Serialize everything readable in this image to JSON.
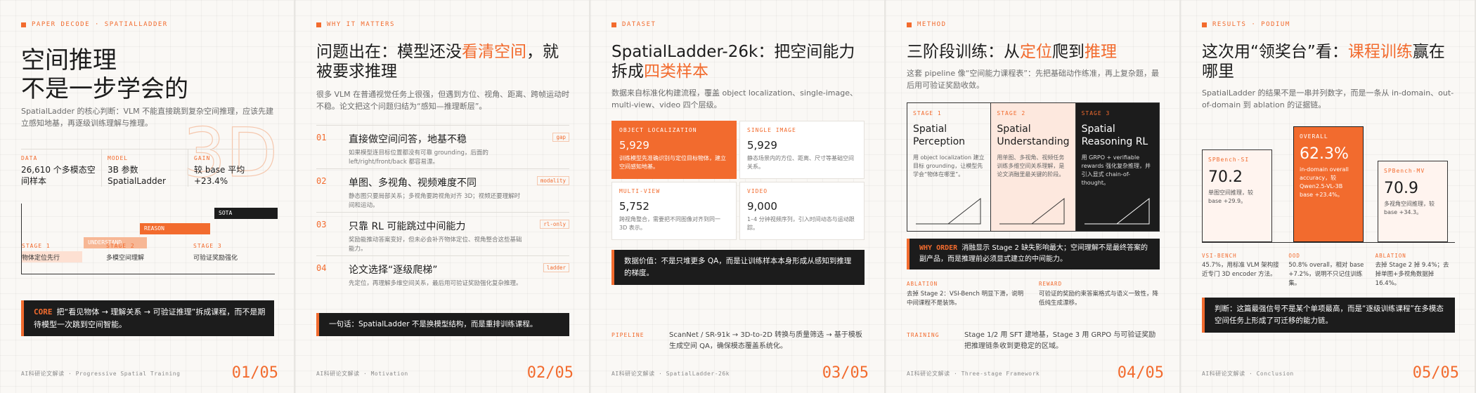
{
  "slides": [
    {
      "kicker": "PAPER DECODE · SPATIALLADDER",
      "title_line1": "空间推理",
      "title_line2": "不是一步学会的",
      "lead": "SpatialLadder 的核心判断：VLM 不能直接跳到复杂空间推理，应该先建立感知地基，再逐级训练理解与推理。",
      "big_text": "3D",
      "stats": [
        {
          "label": "DATA",
          "value": "26,610 个多模态空间样本"
        },
        {
          "label": "MODEL",
          "value": "3B 参数 SpatialLadder"
        },
        {
          "label": "GAIN",
          "value": "较 base 平均 +23.4%"
        }
      ],
      "ladder": {
        "sota": "SOTA",
        "reason": "REASON",
        "understand": "UNDERSTAND",
        "stage1_label": "STAGE 1",
        "stage1_desc": "物体定位先行",
        "stage2_label": "STAGE 2",
        "stage2_desc": "多模空间理解",
        "stage3_label": "STAGE 3",
        "stage3_desc": "可验证奖励强化"
      },
      "core_tag": "CORE",
      "core_text": "把“看见物体 → 理解关系 → 可验证推理”拆成课程，而不是期待模型一次跳到空间智能。",
      "footer_left": "AI科研论文解读 · Progressive Spatial Training",
      "page": "01/05"
    },
    {
      "kicker": "WHY IT MATTERS",
      "title_a": "问题出在：模型还没",
      "title_hl": "看清空间",
      "title_b": "，就被要求推理",
      "lead": "很多 VLM 在普通视觉任务上很强，但遇到方位、视角、距离、跨帧运动时不稳。论文把这个问题归结为“感知—推理断层”。",
      "problems": [
        {
          "num": "01",
          "title": "直接做空间问答，地基不稳",
          "desc": "如果模型连目标位置都没有可靠 grounding，后面的 left/right/front/back 都容易漂。",
          "chip": "gap"
        },
        {
          "num": "02",
          "title": "单图、多视角、视频难度不同",
          "desc": "静态图只要局部关系；多视角要跨视角对齐 3D；视频还要理解时间和运动。",
          "chip": "modality"
        },
        {
          "num": "03",
          "title": "只靠 RL 可能跳过中间能力",
          "desc": "奖励能推动答案变好，但未必会补齐物体定位、视角整合这些基础能力。",
          "chip": "rl-only"
        },
        {
          "num": "04",
          "title": "论文选择“逐级爬梯”",
          "desc": "先定位，再理解多维空间关系，最后用可验证奖励强化复杂推理。",
          "chip": "ladder"
        }
      ],
      "summary": "一句话：SpatialLadder 不是换模型结构，而是重排训练课程。",
      "footer_left": "AI科研论文解读 · Motivation",
      "page": "02/05"
    },
    {
      "kicker": "DATASET",
      "title_a": "SpatialLadder-26k：把空间能力拆成",
      "title_hl": "四类样本",
      "lead": "数据来自标准化构建流程，覆盖 object localization、single-image、multi-view、video 四个层级。",
      "cards": [
        {
          "label": "OBJECT LOCALIZATION",
          "value": "5,929",
          "desc": "训练模型先准确识别与定位目标物体，建立空间感知地基。"
        },
        {
          "label": "SINGLE IMAGE",
          "value": "5,929",
          "desc": "静态场景内的方位、距离、尺寸等基础空间关系。"
        },
        {
          "label": "MULTI-VIEW",
          "value": "5,752",
          "desc": "跨视角整合，需要把不同图像对齐到同一 3D 表示。"
        },
        {
          "label": "VIDEO",
          "value": "9,000",
          "desc": "1–4 分钟视频序列，引入时间动态与运动跟踪。"
        }
      ],
      "value_note": "数据价值：不是只堆更多 QA，而是让训练样本本身形成从感知到推理的梯度。",
      "pipeline_label": "PIPELINE",
      "pipeline_text": "ScanNet / SR-91k → 3D-to-2D 转换与质量筛选 → 基于模板生成空间 QA，确保模态覆盖系统化。",
      "footer_left": "AI科研论文解读 · SpatialLadder-26k",
      "page": "03/05"
    },
    {
      "kicker": "METHOD",
      "title_a": "三阶段训练：从",
      "title_hl1": "定位",
      "title_b": "爬到",
      "title_hl2": "推理",
      "lead": "这套 pipeline 像“空间能力课程表”：先把基础动作练准，再上复杂题，最后用可验证奖励收敛。",
      "stages": [
        {
          "label": "STAGE 1",
          "name": "Spatial Perception",
          "desc": "用 object localization 建立目标 grounding，让模型先学会“物体在哪里”。"
        },
        {
          "label": "STAGE 2",
          "name": "Spatial Understanding",
          "desc": "用单图、多视角、视频任务训练多维空间关系理解，是论文消融里最关键的阶段。"
        },
        {
          "label": "STAGE 3",
          "name": "Spatial Reasoning RL",
          "desc": "用 GRPO + verifiable rewards 强化复杂推理，并引入显式 chain-of-thought。"
        }
      ],
      "order_tag": "WHY ORDER",
      "order_text": "消融显示 Stage 2 缺失影响最大；空间理解不是最终答案的副产品，而是推理前必须显式建立的中间能力。",
      "ablations": [
        {
          "label": "ABLATION",
          "desc": "去掉 Stage 2：VSI-Bench 明显下滑，说明中间课程不是装饰。"
        },
        {
          "label": "REWARD",
          "desc": "可验证的奖励约束答案格式与语义一致性，降低纯生成漂移。"
        }
      ],
      "training_label": "TRAINING",
      "training_text": "Stage 1/2 用 SFT 建地基，Stage 3 用 GRPO 与可验证奖励把推理链条收到更稳定的区域。",
      "footer_left": "AI科研论文解读 · Three-stage Framework",
      "page": "04/05"
    },
    {
      "kicker": "RESULTS · PODIUM",
      "title_a": "这次用“领奖台”看：",
      "title_hl": "课程训练",
      "title_b": "赢在哪里",
      "lead": "SpatialLadder 的结果不是一串并列数字，而是一条从 in-domain、out-of-domain 到 ablation 的证据链。",
      "podium": [
        {
          "label": "SPBench-SI",
          "value": "70.2",
          "desc": "单图空间推理，较 base +29.9。"
        },
        {
          "label": "OVERALL",
          "value": "62.3%",
          "desc": "in-domain overall accuracy，较 Qwen2.5-VL-3B base +23.4%。"
        },
        {
          "label": "SPBench-MV",
          "value": "70.9",
          "desc": "多视角空间推理，较 base +34.3。"
        }
      ],
      "notes": [
        {
          "label": "VSI-BENCH",
          "desc": "45.7%，用标准 VLM 架构接近专门 3D encoder 方法。"
        },
        {
          "label": "OOD",
          "desc": "50.8% overall，相对 base +7.2%，说明不只记住训练集。"
        },
        {
          "label": "ABLATION",
          "desc": "去掉 Stage 2 掉 9.4%；去掉单图+多视角数据掉 16.4%。"
        }
      ],
      "judgement": "判断：这篇最强信号不是某个单项最高，而是“逐级训练课程”在多模态空间任务上形成了可迁移的能力链。",
      "footer_left": "AI科研论文解读 · Conclusion",
      "page": "05/05"
    }
  ]
}
